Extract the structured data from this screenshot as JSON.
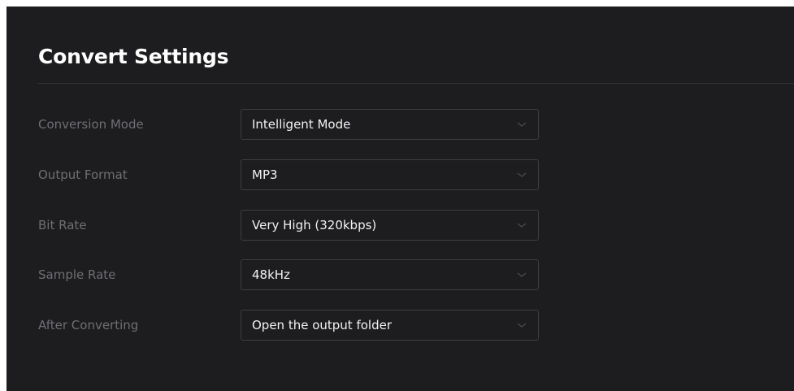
{
  "header": {
    "title": "Convert Settings"
  },
  "settings": [
    {
      "label": "Conversion Mode",
      "value": "Intelligent Mode"
    },
    {
      "label": "Output Format",
      "value": "MP3"
    },
    {
      "label": "Bit Rate",
      "value": "Very High (320kbps)"
    },
    {
      "label": "Sample Rate",
      "value": "48kHz"
    },
    {
      "label": "After Converting",
      "value": "Open the output folder"
    }
  ],
  "icons": {
    "dropdown": "chevron-down-icon"
  },
  "colors": {
    "panel_background": "#1d1d1f",
    "title_text": "#ffffff",
    "label_text": "#6f6f74",
    "value_text": "#f2f2f2",
    "field_border": "#3e3e42"
  }
}
